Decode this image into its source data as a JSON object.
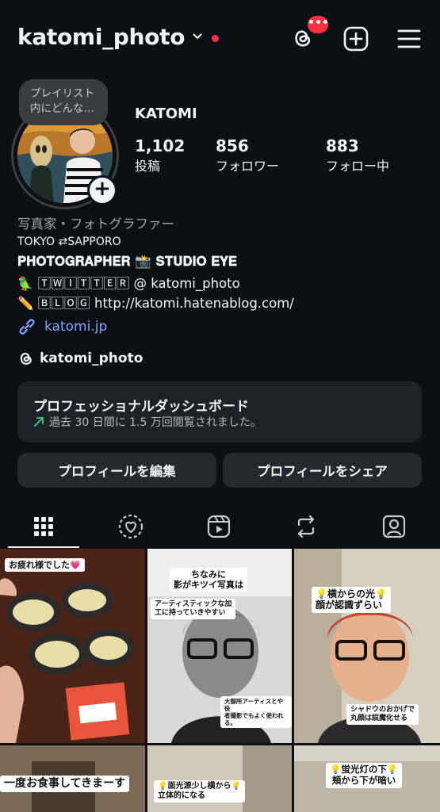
{
  "header": {
    "username": "katomi_photo",
    "notification_count": "•••"
  },
  "profile": {
    "note": "プレイリスト\n内にどんな…",
    "display_name": "KATOMI",
    "stats": [
      {
        "value": "1,102",
        "label": "投稿"
      },
      {
        "value": "856",
        "label": "フォロワー"
      },
      {
        "value": "883",
        "label": "フォロー中"
      }
    ],
    "category": "写真家・フォトグラファー",
    "bio": [
      "TOKYO ⇄SAPPORO",
      "𝐏𝐇𝐎𝐓𝐎𝐆𝐑𝐀𝐏𝐇𝐄𝐑 📸 𝐒𝐓𝐔𝐃𝐈𝐎 𝐄𝐘𝐄",
      "🦜 🅃🅆🄸🅃🅃🄴🅁 @ katomi_photo",
      "✏️ 🄱🄻🄾🄶 http://katomi.hatenablog.com/"
    ],
    "link": "katomi.jp",
    "threads_handle": "katomi_photo"
  },
  "dashboard": {
    "title": "プロフェッショナルダッシュボード",
    "subtitle": "過去 30 日間に 1.5 万回閲覧されました。"
  },
  "buttons": {
    "edit": "プロフィールを編集",
    "share": "プロフィールをシェア"
  },
  "tabs": [
    "grid-icon",
    "tagged-heart-icon",
    "reels-icon",
    "reposts-icon",
    "tagged-user-icon"
  ],
  "grid": [
    {
      "captions": [
        "お疲れ様でした💗"
      ]
    },
    {
      "captions": [
        "ちなみに\n影がキツイ写真は",
        "アーティスティックな加\n工に持っていきやすい",
        "大御所アーティスとや役\n者撮影でもよく使われ\nる。"
      ]
    },
    {
      "captions": [
        "💡横からの光💡\n顔が認識ずらい",
        "シャドウのおかげで\n丸顔は誤魔化せる"
      ]
    },
    {
      "captions": [
        "一度お食事してきまーす"
      ]
    },
    {
      "captions": [
        "💡面光源少し横から💡\n立体的になる"
      ]
    },
    {
      "captions": [
        "💡蛍光灯の下💡\n頬から下が暗い"
      ]
    }
  ],
  "colors": {
    "background": "#0c0f14",
    "accent_red": "#ff3040",
    "link_blue": "#7fa6ff",
    "card": "#1e2127"
  }
}
